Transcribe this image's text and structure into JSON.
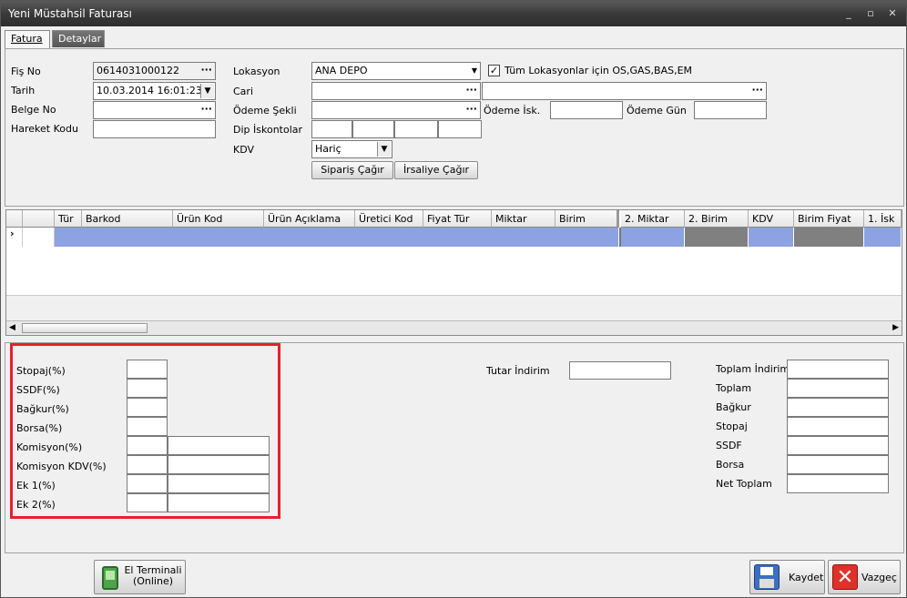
{
  "window": {
    "title": "Yeni Müstahsil Faturası",
    "minimize": "_",
    "maximize": "▫",
    "close": "✕"
  },
  "tabs": [
    "Fatura",
    "Detaylar"
  ],
  "form": {
    "fis_no_label": "Fiş No",
    "fis_no": "0614031000122",
    "tarih_label": "Tarih",
    "tarih": "10.03.2014 16:01:23",
    "belge_no_label": "Belge No",
    "hareket_kodu_label": "Hareket Kodu",
    "lokasyon_label": "Lokasyon",
    "lokasyon": "ANA DEPO",
    "tum_lok_label": "Tüm Lokasyonlar için OS,GAS,BAS,EM",
    "tum_lok_checked": true,
    "cari_label": "Cari",
    "odeme_sekli_label": "Ödeme Şekli",
    "dip_iskonto_label": "Dip İskontolar",
    "kdv_label": "KDV",
    "kdv": "Hariç",
    "odeme_isk_label": "Ödeme İsk.",
    "odeme_gun_label": "Ödeme Gün",
    "siparis_button": "Sipariş Çağır",
    "irsaliye_button": "İrsaliye Çağır",
    "dots": "···"
  },
  "grid": {
    "columns": [
      "Tür",
      "Barkod",
      "Ürün Kod",
      "Ürün Açıklama",
      "Üretici Kod",
      "Fiyat Tür",
      "Miktar",
      "Birim",
      "2. Miktar",
      "2. Birim",
      "KDV",
      "Birim Fiyat",
      "1. İsk"
    ],
    "row_marker": "›",
    "row_color": "#8da2e0",
    "gray_color": "#808080"
  },
  "deductions": {
    "labels": [
      "Stopaj(%)",
      "SSDF(%)",
      "Bağkur(%)",
      "Borsa(%)",
      "Komisyon(%)",
      "Komisyon KDV(%)",
      "Ek 1(%)",
      "Ek 2(%)"
    ]
  },
  "tutar_indirim_label": "Tutar İndirim",
  "totals": {
    "labels": [
      "Toplam İndirim",
      "Toplam",
      "Bağkur",
      "Stopaj",
      "SSDF",
      "Borsa",
      "Net Toplam"
    ]
  },
  "footer": {
    "el_terminali": "El Terminali",
    "online": "(Online)",
    "kaydet": "Kaydet",
    "vazgec": "Vazgeç"
  },
  "highlight_color": "#e8202a"
}
